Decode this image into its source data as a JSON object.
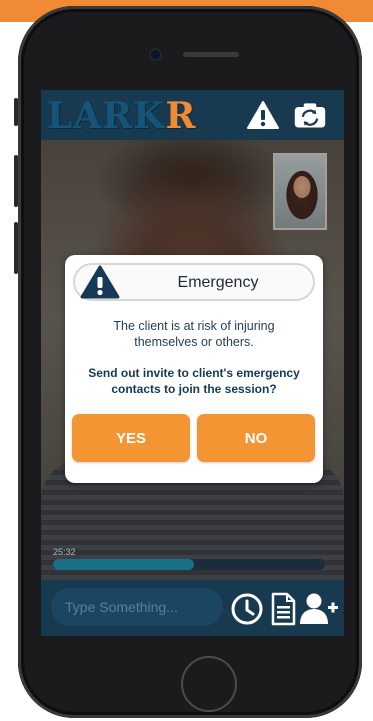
{
  "app": {
    "logo_main": "LARK",
    "logo_accent": "R"
  },
  "header": {
    "alert_icon": "warning-triangle-icon",
    "switch_camera_icon": "switch-camera-icon"
  },
  "session": {
    "elapsed": "25:32",
    "progress": 0.52
  },
  "composer": {
    "placeholder": "Type Something..."
  },
  "dialog": {
    "title": "Emergency",
    "message": "The client is at risk of injuring themselves or others.",
    "question": "Send out invite to client's emergency contacts to join the session?",
    "yes_label": "YES",
    "no_label": "NO"
  },
  "colors": {
    "accent": "#f39533",
    "header": "#183a50",
    "brand": "#17547a",
    "progress": "#1f8aa7"
  }
}
